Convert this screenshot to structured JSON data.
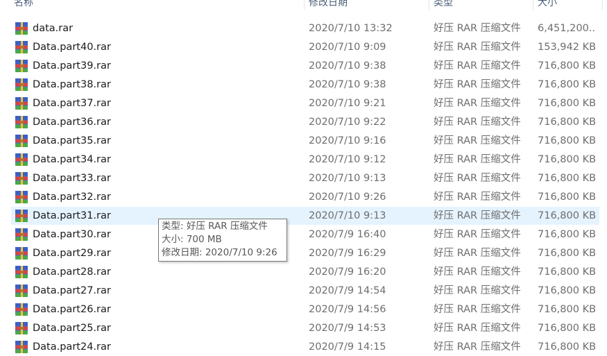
{
  "columns": {
    "name": "名称",
    "date": "修改日期",
    "type": "类型",
    "size": "大小"
  },
  "icon": "winrar-archive-icon",
  "hover_color": "#e5f3ff",
  "files": [
    {
      "name": "data.rar",
      "date": "2020/7/10 13:32",
      "type": "好压 RAR 压缩文件",
      "size": "6,451,200..."
    },
    {
      "name": "Data.part40.rar",
      "date": "2020/7/10 9:09",
      "type": "好压 RAR 压缩文件",
      "size": "153,942 KB"
    },
    {
      "name": "Data.part39.rar",
      "date": "2020/7/10 9:38",
      "type": "好压 RAR 压缩文件",
      "size": "716,800 KB"
    },
    {
      "name": "Data.part38.rar",
      "date": "2020/7/10 9:38",
      "type": "好压 RAR 压缩文件",
      "size": "716,800 KB"
    },
    {
      "name": "Data.part37.rar",
      "date": "2020/7/10 9:21",
      "type": "好压 RAR 压缩文件",
      "size": "716,800 KB"
    },
    {
      "name": "Data.part36.rar",
      "date": "2020/7/10 9:22",
      "type": "好压 RAR 压缩文件",
      "size": "716,800 KB"
    },
    {
      "name": "Data.part35.rar",
      "date": "2020/7/10 9:16",
      "type": "好压 RAR 压缩文件",
      "size": "716,800 KB"
    },
    {
      "name": "Data.part34.rar",
      "date": "2020/7/10 9:12",
      "type": "好压 RAR 压缩文件",
      "size": "716,800 KB"
    },
    {
      "name": "Data.part33.rar",
      "date": "2020/7/10 9:13",
      "type": "好压 RAR 压缩文件",
      "size": "716,800 KB"
    },
    {
      "name": "Data.part32.rar",
      "date": "2020/7/10 9:26",
      "type": "好压 RAR 压缩文件",
      "size": "716,800 KB"
    },
    {
      "name": "Data.part31.rar",
      "date": "2020/7/10 9:13",
      "type": "好压 RAR 压缩文件",
      "size": "716,800 KB",
      "hover": true
    },
    {
      "name": "Data.part30.rar",
      "date": "2020/7/9 16:40",
      "type": "好压 RAR 压缩文件",
      "size": "716,800 KB"
    },
    {
      "name": "Data.part29.rar",
      "date": "2020/7/9 16:29",
      "type": "好压 RAR 压缩文件",
      "size": "716,800 KB"
    },
    {
      "name": "Data.part28.rar",
      "date": "2020/7/9 16:20",
      "type": "好压 RAR 压缩文件",
      "size": "716,800 KB"
    },
    {
      "name": "Data.part27.rar",
      "date": "2020/7/9 14:54",
      "type": "好压 RAR 压缩文件",
      "size": "716,800 KB"
    },
    {
      "name": "Data.part26.rar",
      "date": "2020/7/9 14:56",
      "type": "好压 RAR 压缩文件",
      "size": "716,800 KB"
    },
    {
      "name": "Data.part25.rar",
      "date": "2020/7/9 14:53",
      "type": "好压 RAR 压缩文件",
      "size": "716,800 KB"
    },
    {
      "name": "Data.part24.rar",
      "date": "2020/7/9 14:15",
      "type": "好压 RAR 压缩文件",
      "size": "716,800 KB"
    }
  ],
  "tooltip": {
    "type_line": "类型: 好压 RAR 压缩文件",
    "size_line": "大小: 700 MB",
    "date_line": "修改日期: 2020/7/10 9:26"
  }
}
